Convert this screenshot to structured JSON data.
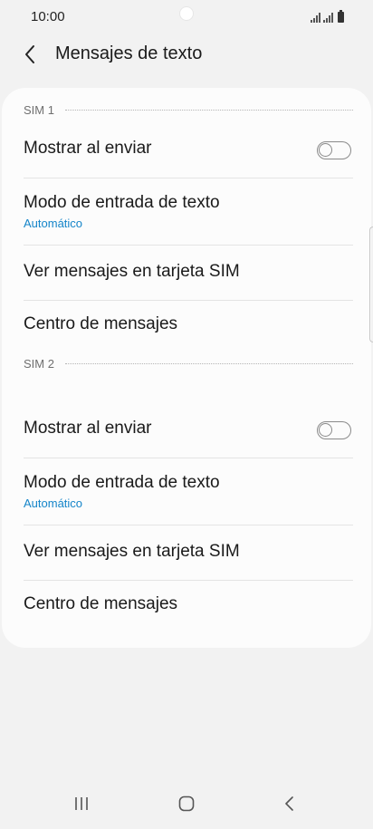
{
  "status_bar": {
    "time": "10:00",
    "icons": [
      "signal-sim1-icon",
      "signal-sim2-icon",
      "battery-icon"
    ]
  },
  "header": {
    "title": "Mensajes de texto",
    "back_icon": "chevron-left-icon"
  },
  "sections": [
    {
      "label": "SIM 1",
      "items": [
        {
          "title": "Mostrar al enviar",
          "toggle": false
        },
        {
          "title": "Modo de entrada de texto",
          "subtitle": "Automático"
        },
        {
          "title": "Ver mensajes en tarjeta SIM"
        },
        {
          "title": "Centro de mensajes"
        }
      ]
    },
    {
      "label": "SIM 2",
      "items": [
        {
          "title": "Mostrar al enviar",
          "toggle": false
        },
        {
          "title": "Modo de entrada de texto",
          "subtitle": "Automático"
        },
        {
          "title": "Ver mensajes en tarjeta SIM"
        },
        {
          "title": "Centro de mensajes"
        }
      ]
    }
  ],
  "nav_bar": {
    "buttons": [
      "recent-apps-icon",
      "home-icon",
      "back-icon"
    ]
  },
  "colors": {
    "background": "#f2f2f2",
    "card": "#fcfcfc",
    "accent": "#1585c9",
    "text": "#1a1a1a",
    "section_label": "#6f6f6f"
  }
}
